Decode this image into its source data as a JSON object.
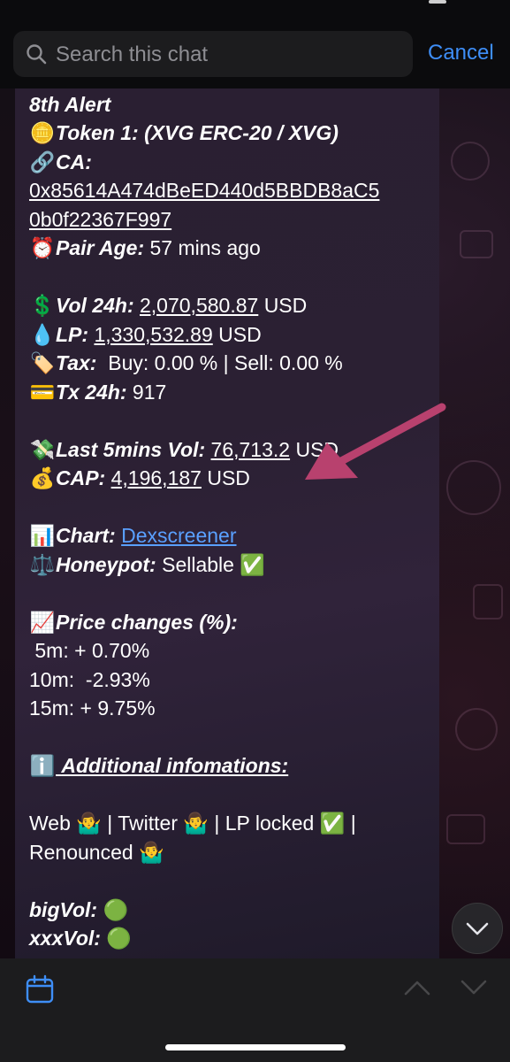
{
  "search": {
    "placeholder": "Search this chat",
    "cancel_label": "Cancel"
  },
  "message": {
    "alert_title": "8th Alert",
    "token_label": "Token 1: (XVG ERC-20 / XVG)",
    "ca_label": "CA:",
    "ca_line1": "0x85614A474dBeED440d5BBDB8aC5",
    "ca_line2": "0b0f22367F997",
    "pair_age_label": "Pair Age:",
    "pair_age_value": "57 mins ago",
    "vol_label": "Vol 24h:",
    "vol_value": "2,070,580.87",
    "lp_label": "LP:",
    "lp_value": "1,330,532.89",
    "usd": "USD",
    "tax_label": "Tax:",
    "tax_value": "Buy: 0.00 % | Sell: 0.00 %",
    "tx_label": "Tx 24h:",
    "tx_value": "917",
    "last5_label": "Last 5mins Vol:",
    "last5_value": "76,713.2",
    "last5_unit": "USD",
    "cap_label": "CAP:",
    "cap_value": "4,196,187",
    "chart_label": "Chart:",
    "chart_link": "Dexscreener",
    "honeypot_label": "Honeypot:",
    "honeypot_value": "Sellable",
    "price_changes_label": "Price changes (%):",
    "pc_5m": " 5m: + 0.70%",
    "pc_10m": "10m:  -2.93%",
    "pc_15m": "15m: + 9.75%",
    "additional_label": "Additional infomations:",
    "links_line1": "Web 🤷‍♂️ | Twitter 🤷‍♂️ | LP locked ✅ |",
    "links_line2": "Renounced 🤷‍♂️",
    "bigvol_label": "bigVol:",
    "xxxvol_label": "xxxVol:"
  },
  "icons": {
    "coin": "🪙",
    "link": "🔗",
    "alarm": "⏰",
    "dollar": "💲",
    "droplet": "💧",
    "tag": "🏷️",
    "card": "💳",
    "money_wings": "💸",
    "money_bag": "💰",
    "bar_chart": "📊",
    "scales": "⚖️",
    "check": "✅",
    "chart_up": "📈",
    "info": "ℹ️",
    "green_circle": "🟢"
  },
  "colors": {
    "accent": "#3e8ef7",
    "link": "#5aa0ff",
    "arrow": "#b8416e",
    "bubble": "#2b2033"
  }
}
